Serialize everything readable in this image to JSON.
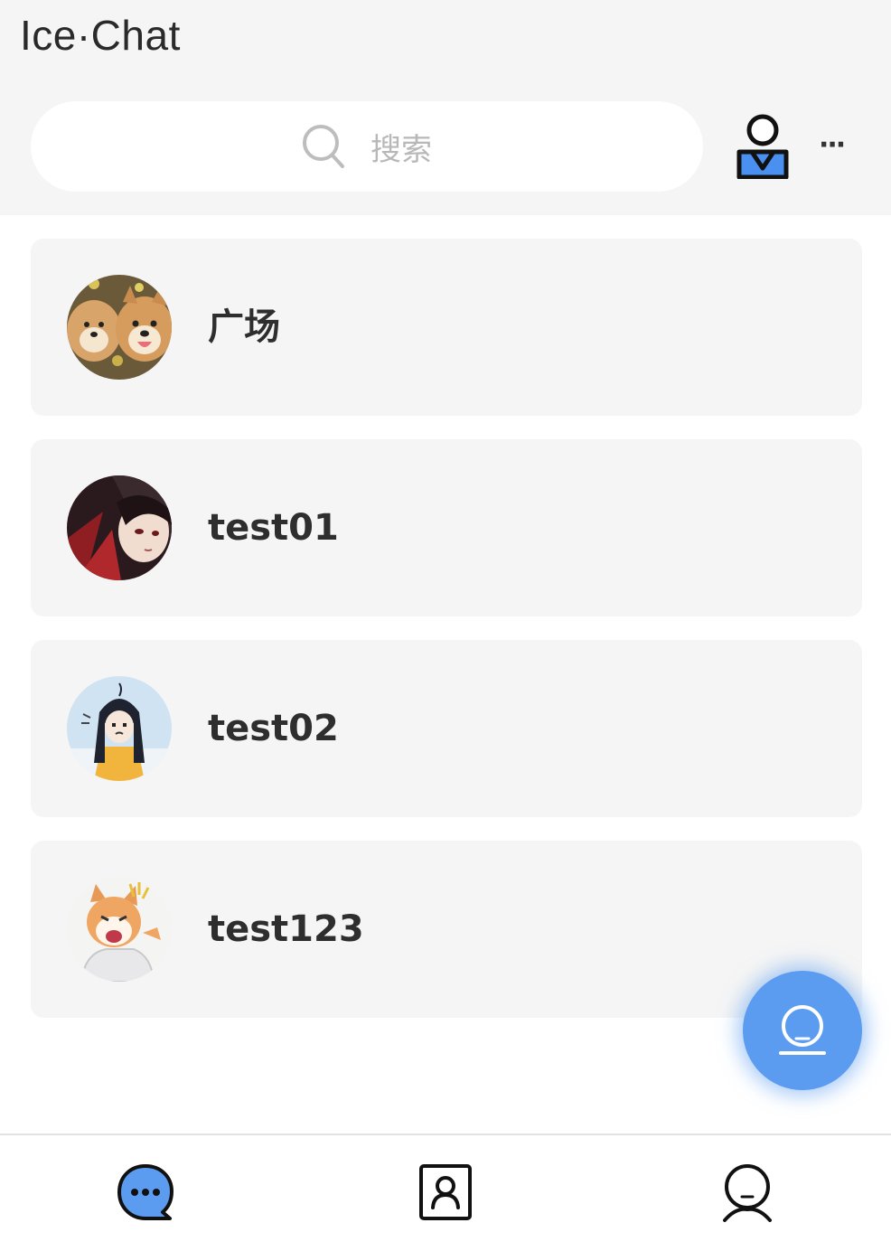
{
  "header": {
    "title": "Ice·Chat",
    "search_placeholder": "搜索",
    "icons": [
      "search-icon",
      "contacts-person-icon",
      "more-icon"
    ],
    "more_label": "···"
  },
  "chats": [
    {
      "name": "广场",
      "avatar": "shiba-dogs-avatar"
    },
    {
      "name": "test01",
      "avatar": "dark-hair-anime-avatar"
    },
    {
      "name": "test02",
      "avatar": "girl-yellow-shirt-avatar"
    },
    {
      "name": "test123",
      "avatar": "cat-cartoon-avatar"
    }
  ],
  "fab": {
    "icon": "robot-face-icon"
  },
  "tabbar": {
    "tabs": [
      {
        "name": "chats",
        "icon": "chat-bubble-icon",
        "active": true
      },
      {
        "name": "contacts",
        "icon": "contact-card-icon",
        "active": false
      },
      {
        "name": "profile",
        "icon": "user-profile-icon",
        "active": false
      }
    ]
  },
  "colors": {
    "accent": "#5b9cf0",
    "header_bg": "#f5f5f5",
    "row_bg": "#f5f5f5"
  }
}
